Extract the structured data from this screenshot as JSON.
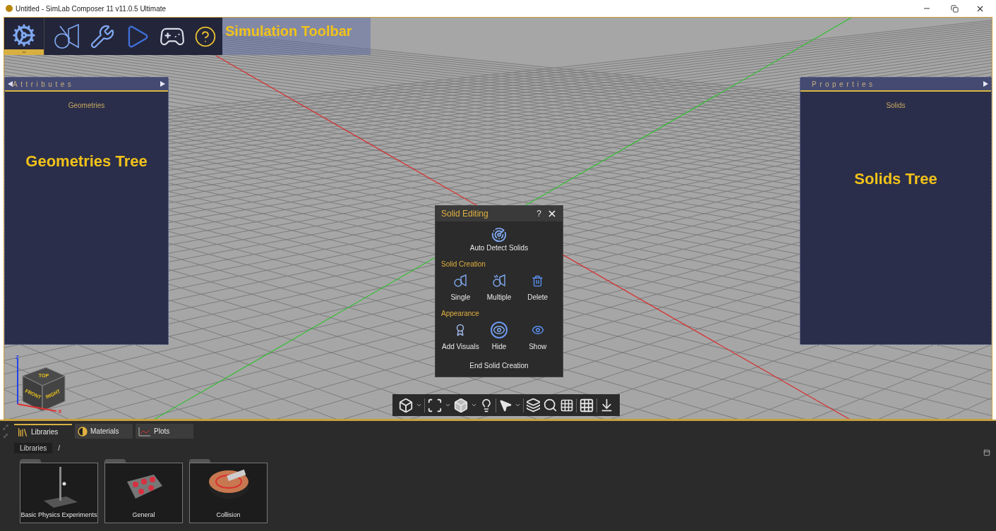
{
  "window": {
    "title": "Untitled - SimLab Composer 11 v11.0.5 Ultimate"
  },
  "toolbar": {
    "annotation": "Simulation Toolbar"
  },
  "attributes_panel": {
    "title": "Attributes",
    "heading": "Geometries",
    "annotation": "Geometries Tree"
  },
  "properties_panel": {
    "title": "Properties",
    "heading": "Solids",
    "annotation": "Solids Tree"
  },
  "dialog": {
    "title": "Solid Editing",
    "help": "?",
    "main_action": "Auto Detect Solids",
    "sections": [
      {
        "title": "Solid Creation",
        "actions": [
          {
            "label": "Single",
            "selected": false
          },
          {
            "label": "Multiple",
            "selected": false
          },
          {
            "label": "Delete",
            "selected": false
          }
        ]
      },
      {
        "title": "Appearance",
        "actions": [
          {
            "label": "Add Visuals",
            "selected": false
          },
          {
            "label": "Hide",
            "selected": true
          },
          {
            "label": "Show",
            "selected": false
          }
        ]
      }
    ],
    "footer": "End Solid Creation"
  },
  "view_cube": {
    "faces": [
      "TOP",
      "FRONT",
      "RIGHT"
    ],
    "axes": [
      "Z",
      "X"
    ]
  },
  "bottom_panel": {
    "tabs": [
      {
        "label": "Libraries",
        "selected": true
      },
      {
        "label": "Materials",
        "selected": false
      },
      {
        "label": "Plots",
        "selected": false
      }
    ],
    "breadcrumb": {
      "path": "Libraries",
      "separator": "/"
    },
    "folders": [
      {
        "label": "Basic Physics Experiments"
      },
      {
        "label": "General"
      },
      {
        "label": "Collision"
      }
    ]
  }
}
